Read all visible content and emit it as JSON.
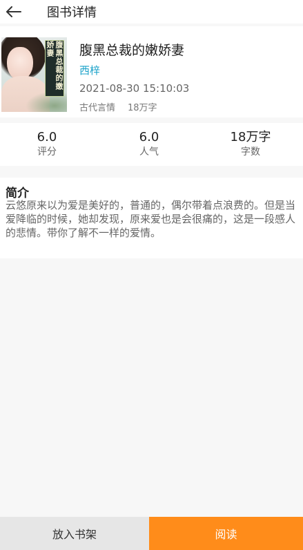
{
  "header": {
    "title": "图书详情",
    "back_icon": "arrow-left-icon"
  },
  "book": {
    "title": "腹黑总裁的嫩娇妻",
    "author": "西梓",
    "date": "2021-08-30 15:10:03",
    "category": "古代言情",
    "words": "18万字",
    "cover_title": "腹黑总裁的嫩娇妻"
  },
  "stats": [
    {
      "value": "6.0",
      "label": "评分"
    },
    {
      "value": "6.0",
      "label": "人气"
    },
    {
      "value": "18万字",
      "label": "字数"
    }
  ],
  "intro": {
    "heading": "简介",
    "text": "云悠原来以为爱是美好的，普通的，偶尔带着点浪费的。但是当爱降临的时候，她却发现，原来爱也是会很痛的，这是一段感人的悲情。带你了解不一样的爱情。"
  },
  "actions": {
    "shelf_label": "放入书架",
    "read_label": "阅读"
  },
  "colors": {
    "accent": "#ff8c1a",
    "author": "#1aa2c9",
    "shelf_bg": "#e6e6e6"
  }
}
